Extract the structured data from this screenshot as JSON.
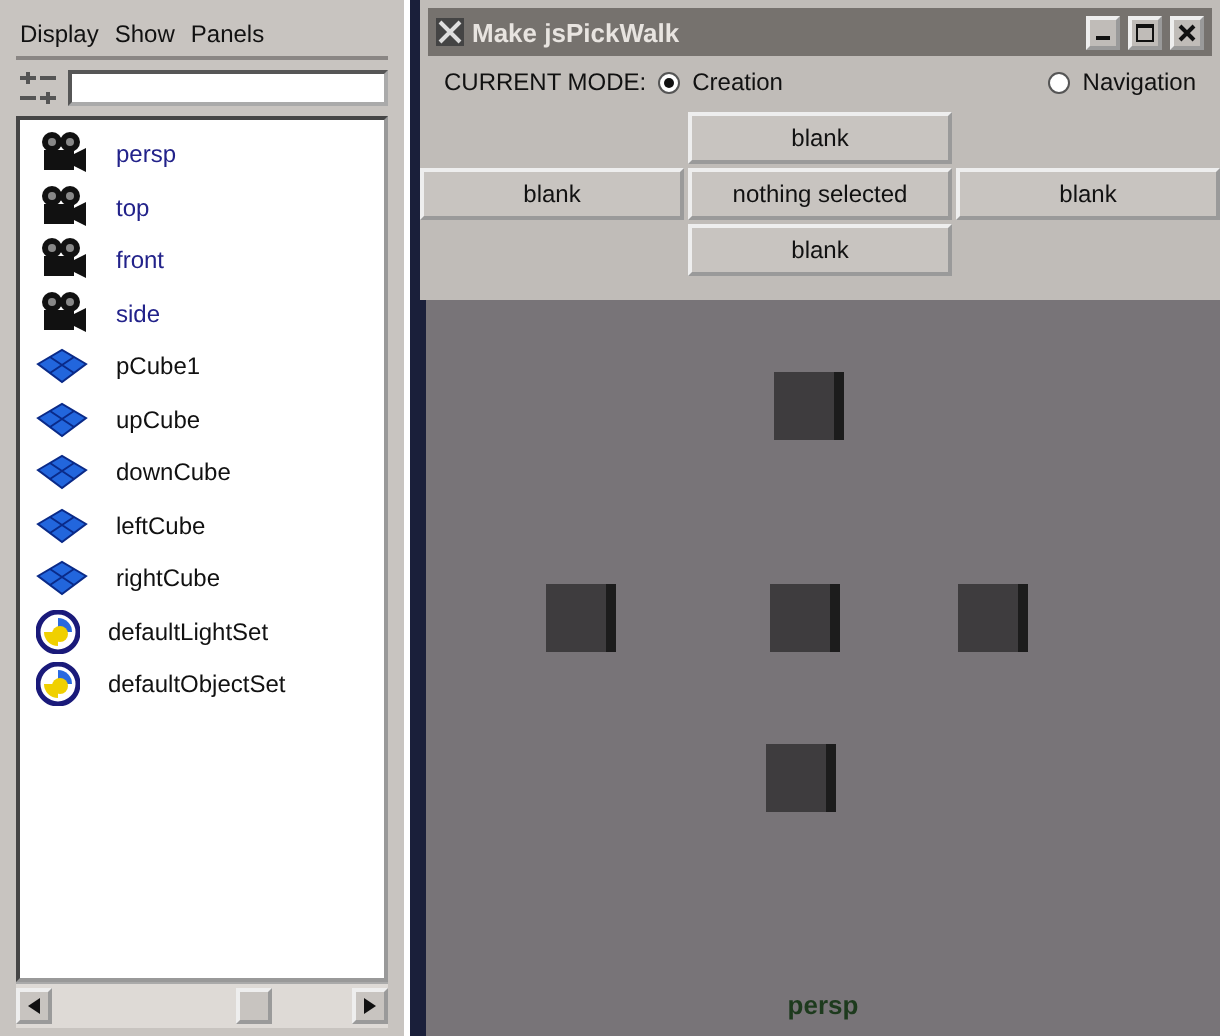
{
  "outliner": {
    "menu": [
      "Display",
      "Show",
      "Panels"
    ],
    "items": [
      {
        "kind": "camera",
        "name": "persp"
      },
      {
        "kind": "camera",
        "name": "top"
      },
      {
        "kind": "camera",
        "name": "front"
      },
      {
        "kind": "camera",
        "name": "side"
      },
      {
        "kind": "mesh",
        "name": "pCube1"
      },
      {
        "kind": "mesh",
        "name": "upCube"
      },
      {
        "kind": "mesh",
        "name": "downCube"
      },
      {
        "kind": "mesh",
        "name": "leftCube"
      },
      {
        "kind": "mesh",
        "name": "rightCube"
      },
      {
        "kind": "set",
        "name": "defaultLightSet"
      },
      {
        "kind": "set",
        "name": "defaultObjectSet"
      }
    ]
  },
  "window": {
    "title": "Make jsPickWalk",
    "mode_label": "CURRENT MODE:",
    "modes": [
      {
        "label": "Creation",
        "selected": true
      },
      {
        "label": "Navigation",
        "selected": false
      }
    ],
    "buttons": {
      "up": "blank",
      "left": "blank",
      "center": "nothing selected",
      "right": "blank",
      "down": "blank"
    }
  },
  "viewport": {
    "label": "persp"
  }
}
